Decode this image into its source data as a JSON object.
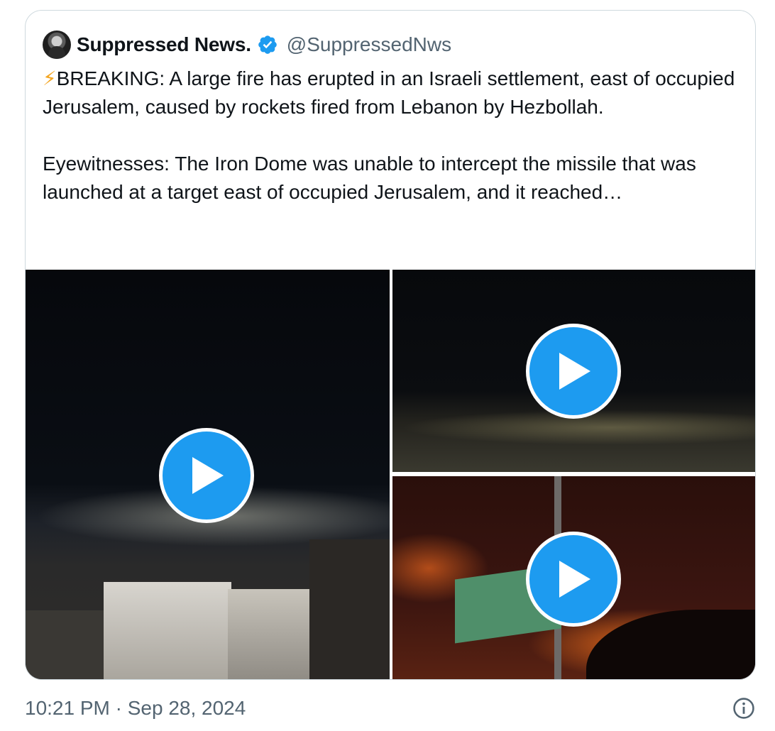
{
  "author": {
    "name": "Suppressed News.",
    "handle": "@SuppressedNws",
    "avatar_icon": "avatar-image",
    "verified_icon": "verified-badge-icon",
    "verified_color": "#1d9bf0"
  },
  "tweet": {
    "emoji": "⚡",
    "paragraph1": "BREAKING: A large fire has erupted in an Israeli settlement, east of occupied Jerusalem, caused by rockets fired from Lebanon by Hezbollah.",
    "paragraph2": "Eyewitnesses: The Iron Dome was unable to intercept the missile that was launched at a target east of occupied Jerusalem, and it reached…"
  },
  "media": {
    "play_icon": "play-icon",
    "play_color": "#1d9bf0",
    "videos": [
      {
        "description_name": "night-city-video"
      },
      {
        "description_name": "night-lights-video"
      },
      {
        "description_name": "fire-flag-video"
      }
    ]
  },
  "footer": {
    "timestamp": "10:21 PM · Sep 28, 2024",
    "info_icon": "info-icon"
  }
}
